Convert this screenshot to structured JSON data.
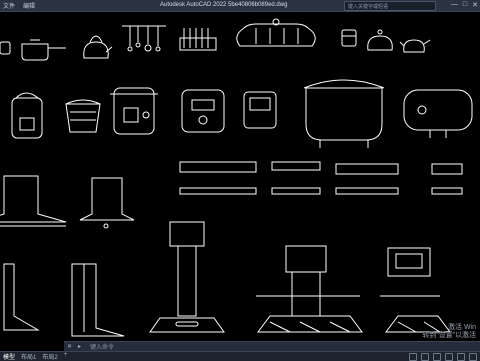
{
  "titlebar": {
    "menu": [
      "文件",
      "编辑"
    ],
    "title": "Autodesk AutoCAD 2022   5be40806b089ed.dwg",
    "search_placeholder": "键入关键字或短语",
    "controls": [
      "—",
      "□",
      "✕"
    ]
  },
  "canvas": {
    "background": "#000000",
    "line_color": "#ffffff",
    "overlay_text": [
      "激活 Win",
      "转到“设置”以激活"
    ]
  },
  "command_bar": {
    "close_label": "✕",
    "prompt_label": "▸",
    "input_placeholder": "键入命令"
  },
  "status_bar": {
    "tabs": [
      "模型",
      "布局1",
      "布局2"
    ],
    "active_tab": "模型",
    "add_tab": "+"
  }
}
